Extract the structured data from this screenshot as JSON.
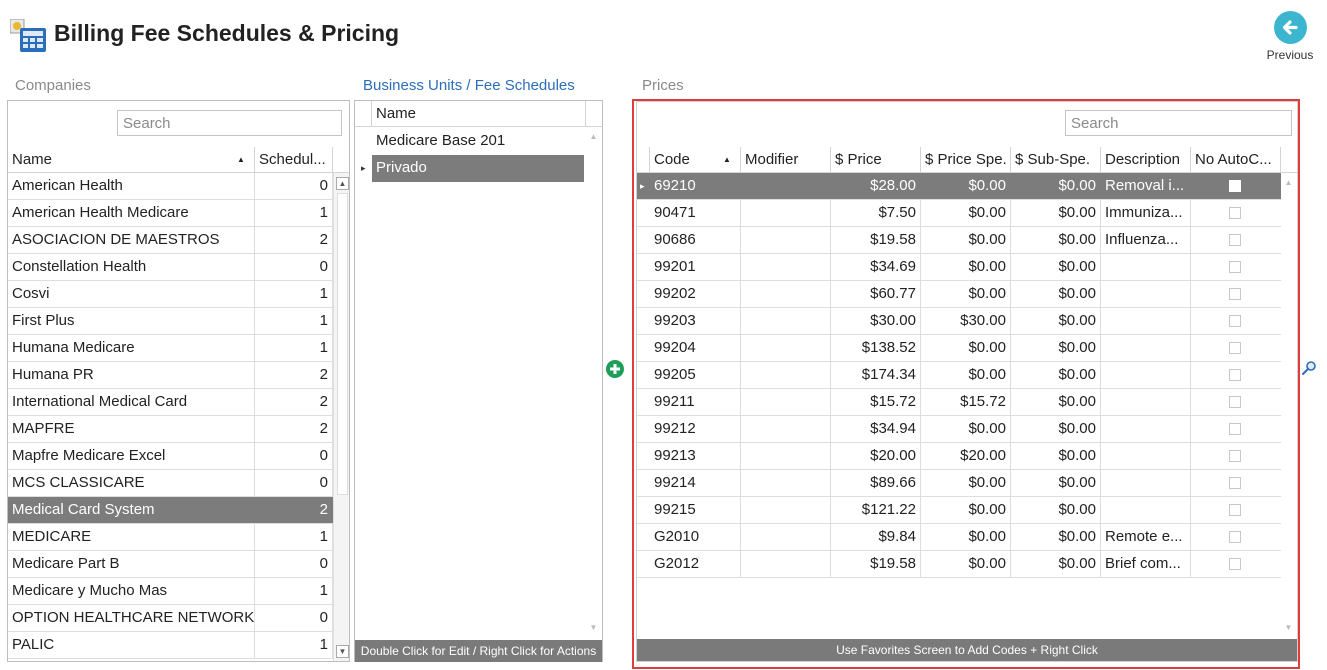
{
  "header": {
    "title": "Billing Fee Schedules & Pricing",
    "previous_label": "Previous",
    "app_icon": "calculator-icon",
    "previous_icon": "arrow-left-icon"
  },
  "companies": {
    "label": "Companies",
    "search_placeholder": "Search",
    "columns": [
      "Name",
      "Schedul..."
    ],
    "sort_indicator": "▲",
    "selected_index": 12,
    "rows": [
      {
        "name": "American Health",
        "schedules": "0"
      },
      {
        "name": "American Health Medicare",
        "schedules": "1"
      },
      {
        "name": "ASOCIACION DE MAESTROS",
        "schedules": "2"
      },
      {
        "name": "Constellation Health",
        "schedules": "0"
      },
      {
        "name": "Cosvi",
        "schedules": "1"
      },
      {
        "name": "First Plus",
        "schedules": "1"
      },
      {
        "name": "Humana Medicare",
        "schedules": "1"
      },
      {
        "name": "Humana PR",
        "schedules": "2"
      },
      {
        "name": "International Medical Card",
        "schedules": "2"
      },
      {
        "name": "MAPFRE",
        "schedules": "2"
      },
      {
        "name": "Mapfre Medicare Excel",
        "schedules": "0"
      },
      {
        "name": "MCS CLASSICARE",
        "schedules": "0"
      },
      {
        "name": "Medical Card System",
        "schedules": "2"
      },
      {
        "name": "MEDICARE",
        "schedules": "1"
      },
      {
        "name": "Medicare Part B",
        "schedules": "0"
      },
      {
        "name": "Medicare y Mucho Mas",
        "schedules": "1"
      },
      {
        "name": "OPTION HEALTHCARE NETWORK",
        "schedules": "0"
      },
      {
        "name": "PALIC",
        "schedules": "1"
      }
    ]
  },
  "business_units": {
    "label": "Business Units / Fee Schedules",
    "column": "Name",
    "rows": [
      "Medicare Base 201",
      "Privado"
    ],
    "selected_index": 1,
    "footer": "Double Click for Edit / Right Click for Actions",
    "add_icon": "plus-circle-icon"
  },
  "prices": {
    "label": "Prices",
    "search_placeholder": "Search",
    "columns": [
      "Code",
      "Modifier",
      "$ Price",
      "$ Price Spe.",
      "$ Sub-Spe.",
      "Description",
      "No AutoC..."
    ],
    "sort_indicator": "▲",
    "selected_index": 0,
    "rows": [
      {
        "code": "69210",
        "modifier": "",
        "price": "$28.00",
        "price_spe": "$0.00",
        "sub_spe": "$0.00",
        "description": "Removal i...",
        "no_auto": false
      },
      {
        "code": "90471",
        "modifier": "",
        "price": "$7.50",
        "price_spe": "$0.00",
        "sub_spe": "$0.00",
        "description": "Immuniza...",
        "no_auto": false
      },
      {
        "code": "90686",
        "modifier": "",
        "price": "$19.58",
        "price_spe": "$0.00",
        "sub_spe": "$0.00",
        "description": "Influenza...",
        "no_auto": false
      },
      {
        "code": "99201",
        "modifier": "",
        "price": "$34.69",
        "price_spe": "$0.00",
        "sub_spe": "$0.00",
        "description": "",
        "no_auto": false
      },
      {
        "code": "99202",
        "modifier": "",
        "price": "$60.77",
        "price_spe": "$0.00",
        "sub_spe": "$0.00",
        "description": "",
        "no_auto": false
      },
      {
        "code": "99203",
        "modifier": "",
        "price": "$30.00",
        "price_spe": "$30.00",
        "sub_spe": "$0.00",
        "description": "",
        "no_auto": false
      },
      {
        "code": "99204",
        "modifier": "",
        "price": "$138.52",
        "price_spe": "$0.00",
        "sub_spe": "$0.00",
        "description": "",
        "no_auto": false
      },
      {
        "code": "99205",
        "modifier": "",
        "price": "$174.34",
        "price_spe": "$0.00",
        "sub_spe": "$0.00",
        "description": "",
        "no_auto": false
      },
      {
        "code": "99211",
        "modifier": "",
        "price": "$15.72",
        "price_spe": "$15.72",
        "sub_spe": "$0.00",
        "description": "",
        "no_auto": false
      },
      {
        "code": "99212",
        "modifier": "",
        "price": "$34.94",
        "price_spe": "$0.00",
        "sub_spe": "$0.00",
        "description": "",
        "no_auto": false
      },
      {
        "code": "99213",
        "modifier": "",
        "price": "$20.00",
        "price_spe": "$20.00",
        "sub_spe": "$0.00",
        "description": "",
        "no_auto": false
      },
      {
        "code": "99214",
        "modifier": "",
        "price": "$89.66",
        "price_spe": "$0.00",
        "sub_spe": "$0.00",
        "description": "",
        "no_auto": false
      },
      {
        "code": "99215",
        "modifier": "",
        "price": "$121.22",
        "price_spe": "$0.00",
        "sub_spe": "$0.00",
        "description": "",
        "no_auto": false
      },
      {
        "code": "G2010",
        "modifier": "",
        "price": "$9.84",
        "price_spe": "$0.00",
        "sub_spe": "$0.00",
        "description": "Remote e...",
        "no_auto": false
      },
      {
        "code": "G2012",
        "modifier": "",
        "price": "$19.58",
        "price_spe": "$0.00",
        "sub_spe": "$0.00",
        "description": "Brief com...",
        "no_auto": false
      }
    ],
    "footer": "Use Favorites Screen to Add Codes + Right Click",
    "search_icon": "magnifier-icon"
  },
  "colors": {
    "selection": "#7c7c7c",
    "highlight_border": "#e03c3c",
    "accent_blue": "#2a6ebb",
    "previous_button": "#3bb6ce",
    "add_button": "#1f9e5a"
  }
}
